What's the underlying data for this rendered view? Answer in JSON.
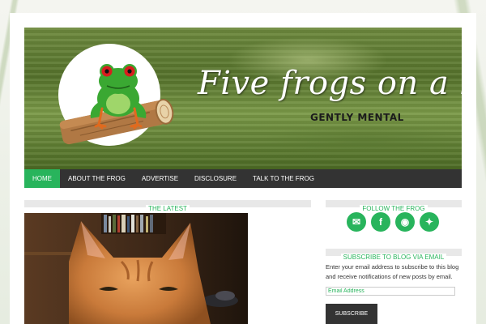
{
  "header": {
    "title": "Five frogs on a blog",
    "tagline": "GENTLY MENTAL",
    "logo_icon": "frog-on-log-icon"
  },
  "nav": {
    "items": [
      {
        "label": "HOME",
        "active": true
      },
      {
        "label": "ABOUT THE FROG",
        "active": false
      },
      {
        "label": "ADVERTISE",
        "active": false
      },
      {
        "label": "DISCLOSURE",
        "active": false
      },
      {
        "label": "TALK TO THE FROG",
        "active": false
      }
    ]
  },
  "main": {
    "section_title": "THE LATEST",
    "post_image_icon": "cat-photo"
  },
  "sidebar": {
    "follow_title": "FOLLOW THE FROG",
    "social": [
      {
        "name": "email-icon",
        "glyph": "✉"
      },
      {
        "name": "facebook-icon",
        "glyph": "f"
      },
      {
        "name": "rss-icon",
        "glyph": "◉"
      },
      {
        "name": "twitter-icon",
        "glyph": "✦"
      }
    ],
    "subscribe_title": "SUBSCRIBE TO BLOG VIA EMAIL",
    "subscribe_text": "Enter your email address to subscribe to this blog and receive notifications of new posts by email.",
    "email_placeholder": "Email Address",
    "subscribe_button": "SUBSCRIBE"
  },
  "colors": {
    "accent": "#28b45c",
    "nav_bg": "#333333"
  }
}
